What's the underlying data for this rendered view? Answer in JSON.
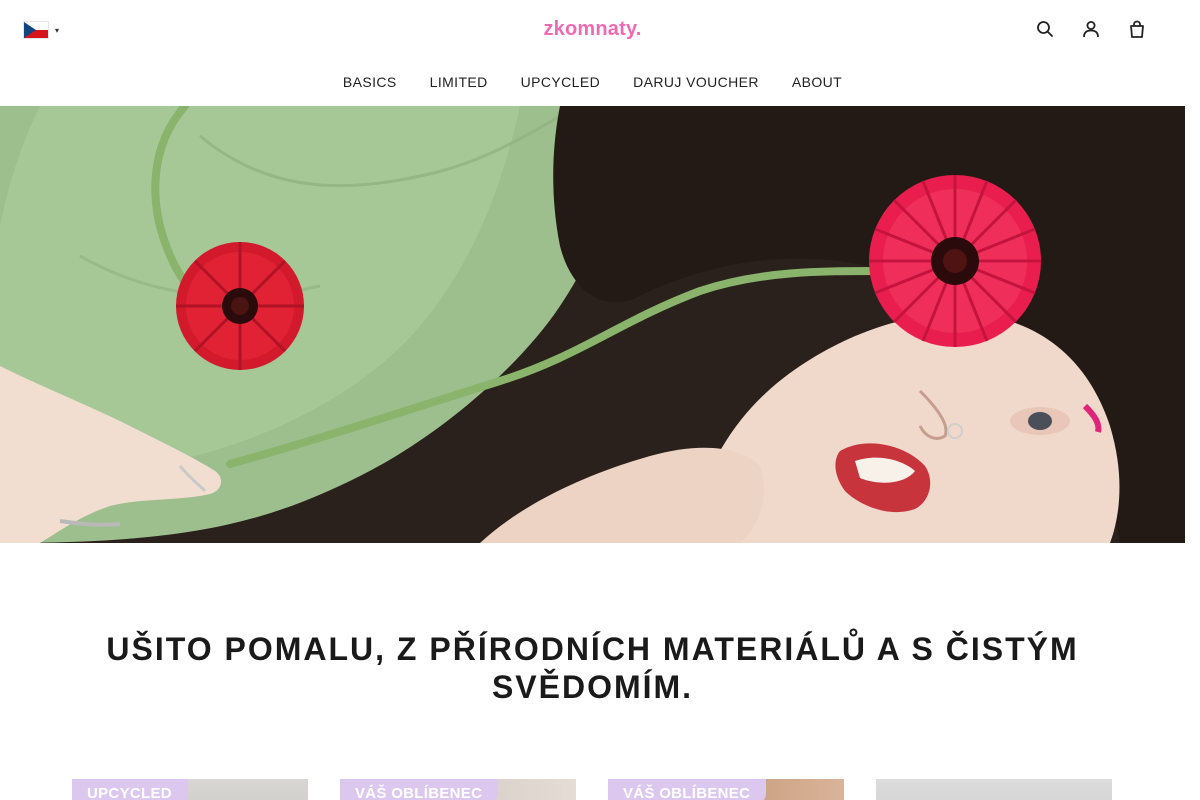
{
  "header": {
    "language": {
      "flag": "czech-flag",
      "caret": "chevron-down-icon"
    },
    "logo": "zkomnaty.",
    "icons": [
      {
        "name": "search-icon",
        "count": ""
      },
      {
        "name": "account-icon",
        "count": ""
      },
      {
        "name": "cart-icon",
        "count": ""
      }
    ]
  },
  "nav": {
    "items": [
      "BASICS",
      "LIMITED",
      "UPCYCLED",
      "DARUJ VOUCHER",
      "ABOUT"
    ]
  },
  "hero": {
    "image": "woman-with-red-gerbera-flowers"
  },
  "headline": "UŠITO POMALU, Z PŘÍRODNÍCH MATERIÁLŮ A S ČISTÝM SVĚDOMÍM.",
  "products": [
    {
      "badge": "UPCYCLED"
    },
    {
      "badge": "VÁŠ OBLÍBENEC"
    },
    {
      "badge": "VÁŠ OBLÍBENEC"
    },
    {
      "badge": ""
    }
  ],
  "colors": {
    "logo": "#f06ab2",
    "badge": "#dcc7ee",
    "text": "#1a1a1a"
  }
}
